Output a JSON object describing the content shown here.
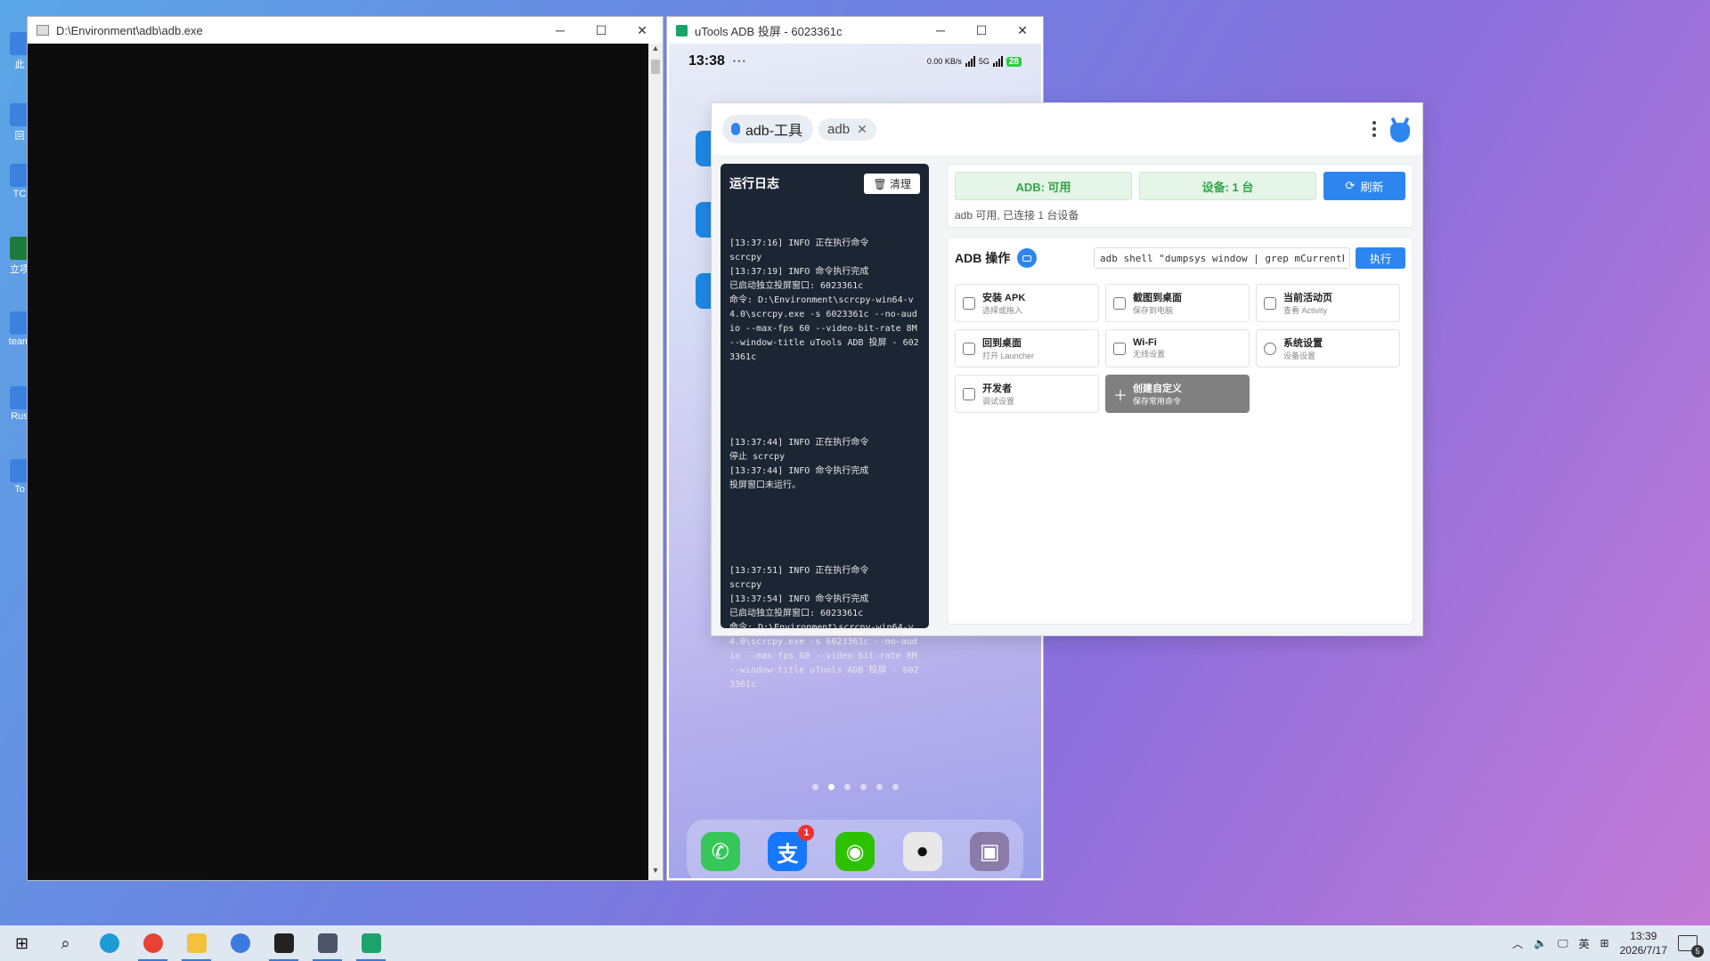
{
  "desktop": {
    "icons": [
      "此",
      "回",
      "TC",
      "立项",
      "team",
      "Rus",
      "To"
    ]
  },
  "cmd_window": {
    "title": "D:\\Environment\\adb\\adb.exe",
    "minimize": "─",
    "maximize": "☐",
    "close": "✕"
  },
  "phone_window": {
    "title": "uTools ADB 投屏 - 6023361c",
    "minimize": "─",
    "maximize": "☐",
    "close": "✕",
    "status_time": "13:38",
    "status_dots": "···",
    "net_speed": "0.00 KB/s",
    "net_type": "5G",
    "battery": "28",
    "dock_badge": "1"
  },
  "tool": {
    "tab_main": "adb-工具",
    "tab_sub": "adb",
    "tab_close": "✕",
    "log": {
      "title": "运行日志",
      "clear": "清理",
      "entries": [
        "[13:37:16] INFO 正在执行命令\nscrcpy\n[13:37:19] INFO 命令执行完成\n已启动独立投屏窗口: 6023361c\n命令: D:\\Environment\\scrcpy-win64-v4.0\\scrcpy.exe -s 6023361c --no-audio --max-fps 60 --video-bit-rate 8M --window-title uTools ADB 投屏 - 6023361c",
        "[13:37:44] INFO 正在执行命令\n停止 scrcpy\n[13:37:44] INFO 命令执行完成\n投屏窗口未运行。",
        "[13:37:51] INFO 正在执行命令\nscrcpy\n[13:37:54] INFO 命令执行完成\n已启动独立投屏窗口: 6023361c\n命令: D:\\Environment\\scrcpy-win64-v4.0\\scrcpy.exe -s 6023361c --no-audio --max-fps 60 --video-bit-rate 8M --window-title uTools ADB 投屏 - 6023361c"
      ]
    },
    "status": {
      "adb": "ADB: 可用",
      "devices": "设备: 1 台",
      "refresh": "刷新",
      "message": "adb 可用, 已连接 1 台设备"
    },
    "ops": {
      "title": "ADB 操作",
      "command_value": "adb shell \"dumpsys window | grep mCurrentF",
      "execute": "执行",
      "buttons": [
        {
          "title": "安装 APK",
          "sub": "选择或拖入"
        },
        {
          "title": "截图到桌面",
          "sub": "保存到电脑"
        },
        {
          "title": "当前活动页",
          "sub": "查看 Activity"
        },
        {
          "title": "回到桌面",
          "sub": "打开 Launcher"
        },
        {
          "title": "Wi-Fi",
          "sub": "无线设置"
        },
        {
          "title": "系统设置",
          "sub": "设备设置"
        },
        {
          "title": "开发者",
          "sub": "调试设置"
        },
        {
          "title": "创建自定义",
          "sub": "保存常用命令"
        }
      ]
    }
  },
  "taskbar": {
    "ime": "英",
    "time": "13:39",
    "date": "2026/7/17",
    "notifications": "5"
  },
  "colors": {
    "accent": "#2d86f0",
    "ok_green": "#33a34a",
    "log_bg": "#1c2533"
  }
}
